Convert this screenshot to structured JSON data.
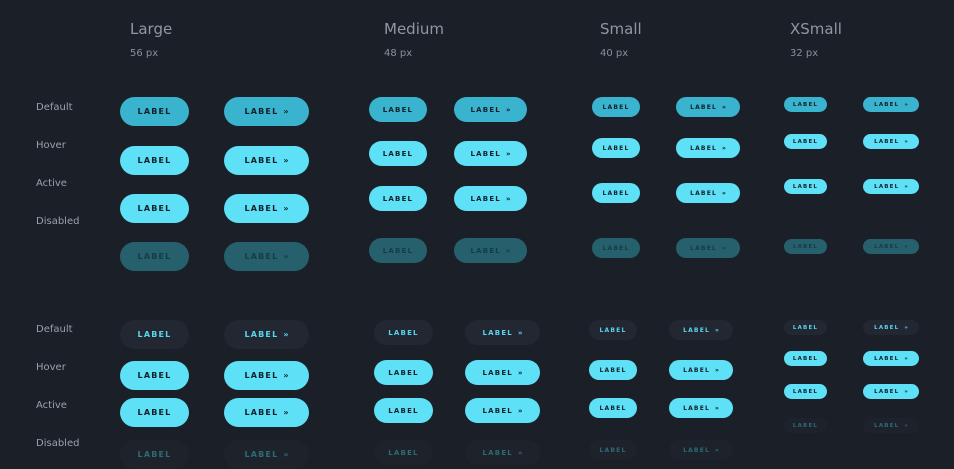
{
  "sizes": [
    {
      "title": "Large",
      "subtitle": "56 px"
    },
    {
      "title": "Medium",
      "subtitle": "48 px"
    },
    {
      "title": "Small",
      "subtitle": "40 px"
    },
    {
      "title": "XSmall",
      "subtitle": "32 px"
    }
  ],
  "states": [
    "Default",
    "Hover",
    "Active",
    "Disabled"
  ],
  "button": {
    "label": "LABEL",
    "arrow": "»"
  },
  "colors": {
    "background": "#1b1f27",
    "accent": "#5ee0f7",
    "accent_default": "#3ab3cf",
    "disabled": "#25606c",
    "ghost_bg": "#222732"
  }
}
